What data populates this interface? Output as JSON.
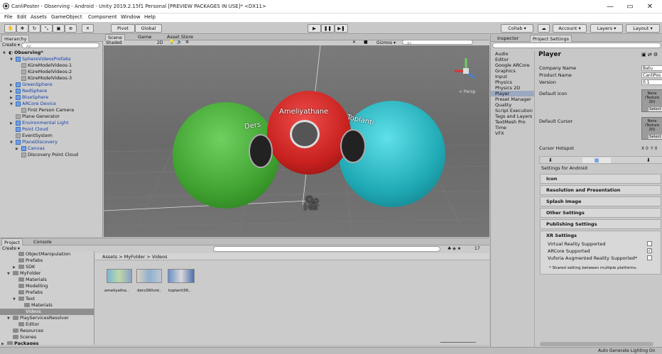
{
  "window": {
    "title": "CanliPoster - Observing - Android - Unity 2019.2.15f1 Personal [PREVIEW PACKAGES IN USE]* <DX11>",
    "min": "—",
    "max": "▭",
    "close": "✕"
  },
  "menu": [
    "File",
    "Edit",
    "Assets",
    "GameObject",
    "Component",
    "Window",
    "Help"
  ],
  "toolbar": {
    "pivot": "Pivot",
    "global": "Global",
    "collab": "Collab ▾",
    "account": "Account ▾",
    "layers": "Layers ▾",
    "layout": "Layout ▾",
    "cloud": "☁"
  },
  "hierarchy": {
    "tab": "Hierarchy",
    "create": "Create ▾",
    "search_placeholder": "All",
    "scene": "Observing*",
    "items": [
      {
        "label": "SphereVideosPrefabs",
        "indent": 1,
        "type": "blue",
        "arrow": "▼"
      },
      {
        "label": "KüreModelVideos-1",
        "indent": 2,
        "type": "gray",
        "arrow": ""
      },
      {
        "label": "KüreModelVideos-2",
        "indent": 2,
        "type": "gray",
        "arrow": ""
      },
      {
        "label": "KüreModelVideos-3",
        "indent": 2,
        "type": "gray",
        "arrow": ""
      },
      {
        "label": "GreenSphere",
        "indent": 1,
        "type": "blue",
        "arrow": "▶"
      },
      {
        "label": "RedSphere",
        "indent": 1,
        "type": "blue",
        "arrow": "▶"
      },
      {
        "label": "BlueSphere",
        "indent": 1,
        "type": "blue",
        "arrow": "▶"
      },
      {
        "label": "ARCore Device",
        "indent": 1,
        "type": "blue",
        "arrow": "▼"
      },
      {
        "label": "First Person Camera",
        "indent": 2,
        "type": "gray",
        "arrow": ""
      },
      {
        "label": "Plane Generator",
        "indent": 1,
        "type": "gray",
        "arrow": ""
      },
      {
        "label": "Environmental Light",
        "indent": 1,
        "type": "blue",
        "arrow": "▶"
      },
      {
        "label": "Point Cloud",
        "indent": 1,
        "type": "blue",
        "arrow": ""
      },
      {
        "label": "EventSystem",
        "indent": 1,
        "type": "gray",
        "arrow": ""
      },
      {
        "label": "PlaneDiscovery",
        "indent": 1,
        "type": "blue",
        "arrow": "▼"
      },
      {
        "label": "Canvas",
        "indent": 2,
        "type": "blue",
        "arrow": "▶"
      },
      {
        "label": "Discovery Point Cloud",
        "indent": 2,
        "type": "gray",
        "arrow": ""
      }
    ]
  },
  "scene_view": {
    "tabs": [
      "Scene",
      "Game",
      "Asset Store"
    ],
    "shaded": "Shaded",
    "mode2d": "2D",
    "gizmos": "Gizmos ▾",
    "search_placeholder": "All",
    "persp": "< Persp",
    "labels": {
      "left": "Ders",
      "center": "Ameliyathane",
      "right": "Toplantı"
    }
  },
  "colors": {
    "green": "#3fa12f",
    "red": "#c8211f",
    "cyan": "#1fa9b4"
  },
  "inspector": {
    "tabs": [
      "Inspector",
      "Project Settings"
    ],
    "categories": [
      "Audio",
      "Editor",
      "Google ARCore",
      "Graphics",
      "Input",
      "Physics",
      "Physics 2D",
      "Player",
      "Preset Manager",
      "Quality",
      "Script Execution",
      "Tags and Layers",
      "TextMesh Pro",
      "Time",
      "VFX"
    ],
    "selected_category": "Player",
    "title": "Player",
    "company_label": "Company Name",
    "company_value": "Batu",
    "product_label": "Product Name",
    "product_value": "CanliPos",
    "version_label": "Version",
    "version_value": "0.1",
    "default_icon_label": "Default Icon",
    "icon_none": "None (Texture 2D)",
    "select": "Select",
    "default_cursor_label": "Default Cursor",
    "cursor_none": "None (Texture 2D)",
    "hotspot_label": "Cursor Hotspot",
    "hotspot_x": "X 0",
    "hotspot_y": "Y 0",
    "settings_for": "Settings for Android",
    "sections": [
      "Icon",
      "Resolution and Presentation",
      "Splash Image",
      "Other Settings",
      "Publishing Settings"
    ],
    "xr": {
      "title": "XR Settings",
      "rows": [
        {
          "label": "Virtual Reality Supported",
          "checked": false
        },
        {
          "label": "ARCore Supported",
          "checked": true
        },
        {
          "label": "Vuforia Augmented Reality Supported*",
          "checked": false
        }
      ],
      "note": "* Shared setting between multiple platforms."
    }
  },
  "project": {
    "tabs": [
      "Project",
      "Console"
    ],
    "create": "Create ▾",
    "count": "17",
    "breadcrumb": "Assets > MyFolder > Videos",
    "tree": [
      {
        "label": "ObjectManipulation",
        "indent": 2,
        "arrow": ""
      },
      {
        "label": "Prefabs",
        "indent": 2,
        "arrow": ""
      },
      {
        "label": "SDK",
        "indent": 2,
        "arrow": "▶"
      },
      {
        "label": "MyFolder",
        "indent": 1,
        "arrow": "▼"
      },
      {
        "label": "Materials",
        "indent": 2,
        "arrow": ""
      },
      {
        "label": "Modelling",
        "indent": 2,
        "arrow": ""
      },
      {
        "label": "Prefabs",
        "indent": 2,
        "arrow": ""
      },
      {
        "label": "Text",
        "indent": 2,
        "arrow": "▼"
      },
      {
        "label": "Materials",
        "indent": 3,
        "arrow": ""
      },
      {
        "label": "Videos",
        "indent": 2,
        "arrow": "",
        "selected": true
      },
      {
        "label": "PlayServicesResolver",
        "indent": 1,
        "arrow": "▼"
      },
      {
        "label": "Editor",
        "indent": 2,
        "arrow": ""
      },
      {
        "label": "Resources",
        "indent": 1,
        "arrow": ""
      },
      {
        "label": "Scenes",
        "indent": 1,
        "arrow": ""
      },
      {
        "label": "Packages",
        "indent": 0,
        "arrow": "▶",
        "bold": true
      }
    ],
    "assets": [
      "ameliyatha..",
      "ders360vid..",
      "toplanti36.."
    ]
  },
  "status": {
    "right": "Auto Generate Lighting On"
  }
}
